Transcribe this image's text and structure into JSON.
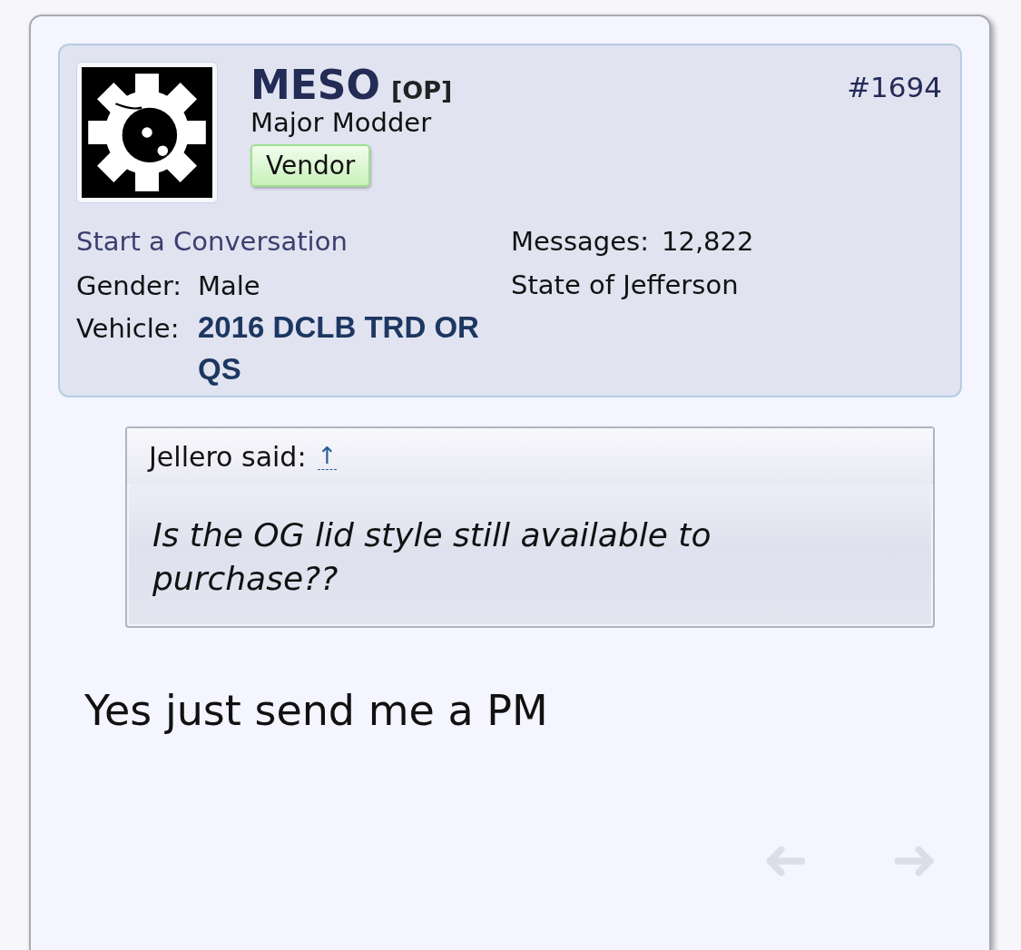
{
  "post": {
    "number": "#1694",
    "author": {
      "name": "MESO",
      "op_tag": "[OP]",
      "title": "Major Modder",
      "badge": "Vendor",
      "conversation_link": "Start a Conversation",
      "fields": [
        {
          "label": "Gender:",
          "value": "Male",
          "kind": "text"
        },
        {
          "label": "Vehicle:",
          "value": "2016 DCLB TRD OR QS",
          "kind": "link"
        }
      ],
      "messages": {
        "label": "Messages:",
        "value": "12,822"
      },
      "location": "State of Jefferson"
    },
    "quote": {
      "author": "Jellero said:",
      "jump": "↑",
      "text": "Is the OG lid style still available to purchase??"
    },
    "body": "Yes just send me a PM"
  }
}
